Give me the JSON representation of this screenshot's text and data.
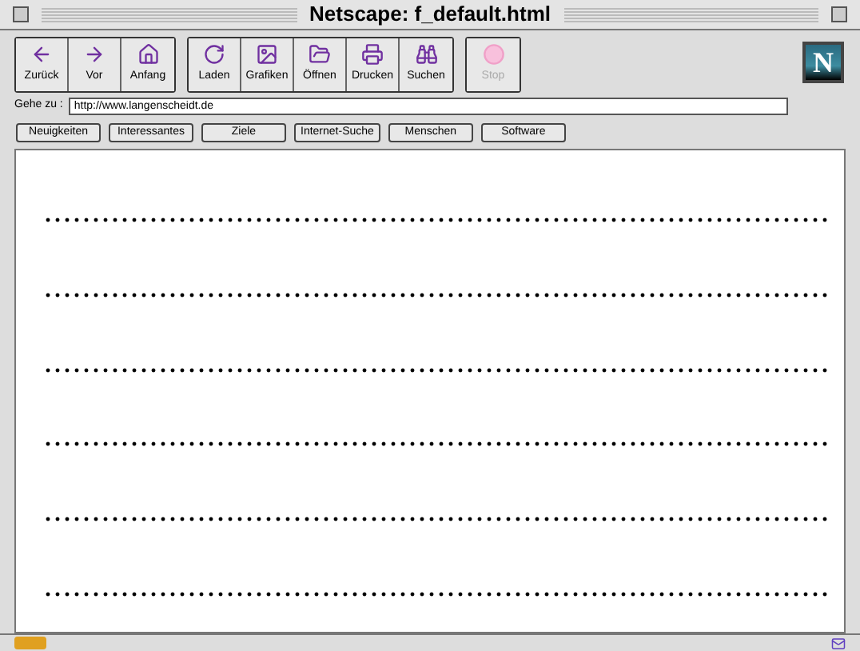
{
  "window": {
    "title": "Netscape: f_default.html"
  },
  "toolbar": {
    "groups": [
      [
        {
          "label": "Zurück",
          "disabled": false
        },
        {
          "label": "Vor",
          "disabled": false
        },
        {
          "label": "Anfang",
          "disabled": false
        }
      ],
      [
        {
          "label": "Laden",
          "disabled": false
        },
        {
          "label": "Grafiken",
          "disabled": false
        },
        {
          "label": "Öffnen",
          "disabled": false
        },
        {
          "label": "Drucken",
          "disabled": false
        },
        {
          "label": "Suchen",
          "disabled": false
        }
      ],
      [
        {
          "label": "Stop",
          "disabled": true
        }
      ]
    ],
    "logo": "N"
  },
  "location": {
    "label": "Gehe zu :",
    "value": "http://www.langenscheidt.de"
  },
  "directory_buttons": [
    "Neuigkeiten",
    "Interessantes",
    "Ziele",
    "Internet-Suche",
    "Menschen",
    "Software"
  ]
}
